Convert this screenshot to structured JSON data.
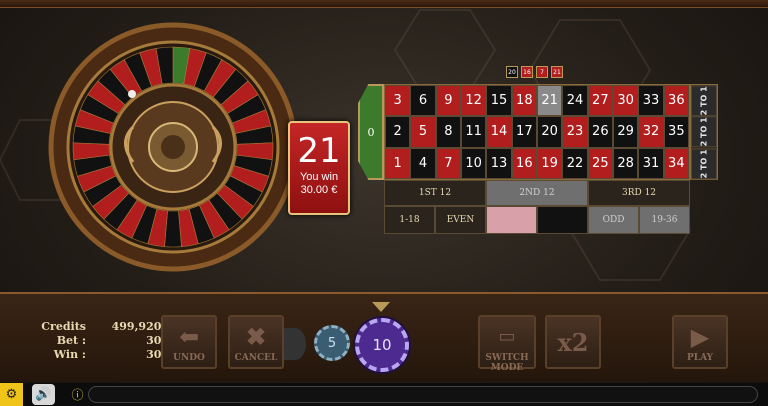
{
  "history": [
    {
      "n": "20",
      "c": "black"
    },
    {
      "n": "16",
      "c": "red"
    },
    {
      "n": "7",
      "c": "red"
    },
    {
      "n": "21",
      "c": "red"
    }
  ],
  "win": {
    "number": "21",
    "label": "You win",
    "amount": "30.00 €"
  },
  "board": {
    "zero": "0",
    "rows": [
      [
        {
          "n": "3",
          "c": "red"
        },
        {
          "n": "6",
          "c": "black"
        },
        {
          "n": "9",
          "c": "red"
        },
        {
          "n": "12",
          "c": "red"
        },
        {
          "n": "15",
          "c": "black"
        },
        {
          "n": "18",
          "c": "red"
        },
        {
          "n": "21",
          "c": "hi"
        },
        {
          "n": "24",
          "c": "black"
        },
        {
          "n": "27",
          "c": "red"
        },
        {
          "n": "30",
          "c": "red"
        },
        {
          "n": "33",
          "c": "black"
        },
        {
          "n": "36",
          "c": "red"
        }
      ],
      [
        {
          "n": "2",
          "c": "black"
        },
        {
          "n": "5",
          "c": "red"
        },
        {
          "n": "8",
          "c": "black"
        },
        {
          "n": "11",
          "c": "black"
        },
        {
          "n": "14",
          "c": "red"
        },
        {
          "n": "17",
          "c": "black"
        },
        {
          "n": "20",
          "c": "black"
        },
        {
          "n": "23",
          "c": "red"
        },
        {
          "n": "26",
          "c": "black"
        },
        {
          "n": "29",
          "c": "black"
        },
        {
          "n": "32",
          "c": "red"
        },
        {
          "n": "35",
          "c": "black"
        }
      ],
      [
        {
          "n": "1",
          "c": "red"
        },
        {
          "n": "4",
          "c": "black"
        },
        {
          "n": "7",
          "c": "red"
        },
        {
          "n": "10",
          "c": "black"
        },
        {
          "n": "13",
          "c": "black"
        },
        {
          "n": "16",
          "c": "red"
        },
        {
          "n": "19",
          "c": "red"
        },
        {
          "n": "22",
          "c": "black"
        },
        {
          "n": "25",
          "c": "red"
        },
        {
          "n": "28",
          "c": "black"
        },
        {
          "n": "31",
          "c": "black"
        },
        {
          "n": "34",
          "c": "red"
        }
      ]
    ],
    "columns": [
      "2 TO 1",
      "2 TO 1",
      "2 TO 1"
    ],
    "dozens": [
      "1ST 12",
      "2ND 12",
      "3RD 12"
    ],
    "outside": [
      "1-18",
      "EVEN",
      "",
      "",
      "ODD",
      "19-36"
    ]
  },
  "info": {
    "credits_label": "Credits :",
    "credits": "499,920.00 €",
    "bet_label": "Bet :",
    "bet": "30.00 €",
    "win_label": "Win :",
    "win": "30.00 €"
  },
  "buttons": {
    "undo": "UNDO",
    "cancel": "CANCEL",
    "switch": "SWITCH MODE",
    "x2": "x2",
    "play": "PLAY"
  },
  "chips": {
    "small": "5",
    "selected": "10"
  },
  "colors": {
    "red": "#b21e1e",
    "black": "#111111",
    "green": "#3c7a2c",
    "gold": "#b79a5a",
    "chip_selected": "#4d2a90"
  }
}
